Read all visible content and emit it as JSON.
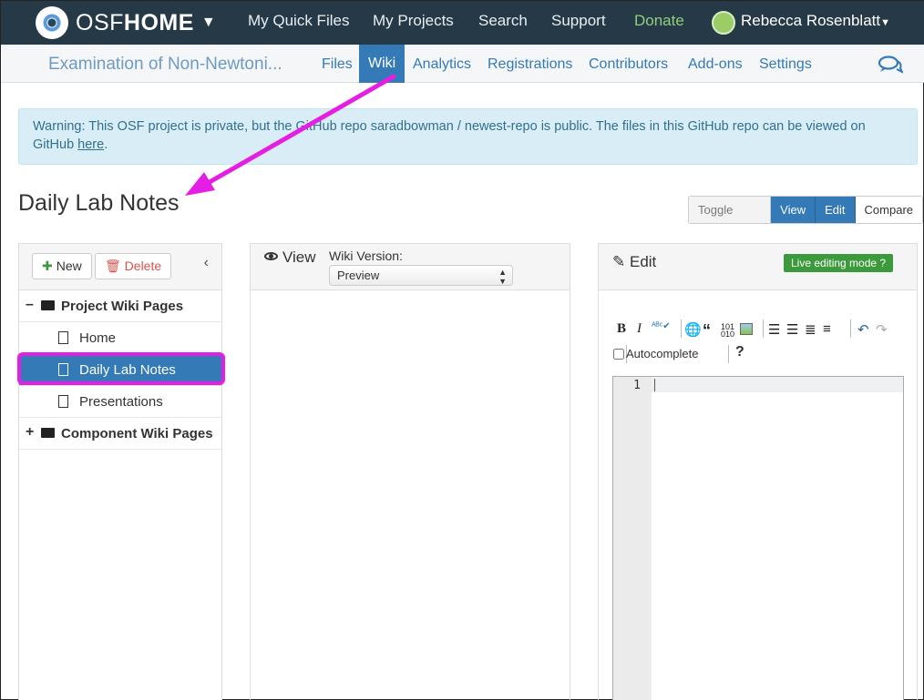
{
  "topnav": {
    "brand_osf": "OSF",
    "brand_home": "HOME",
    "items": [
      "My Quick Files",
      "My Projects",
      "Search",
      "Support",
      "Donate"
    ],
    "user_name": "Rebecca Rosenblatt"
  },
  "subnav": {
    "project_title": "Examination of Non-Newtoni...",
    "items": [
      "Files",
      "Wiki",
      "Analytics",
      "Registrations",
      "Contributors",
      "Add-ons",
      "Settings"
    ],
    "active": "Wiki"
  },
  "warning": {
    "text": "Warning: This OSF project is private, but the GitHub repo saradbowman / newest-repo is public. The files in this GitHub repo can be viewed on GitHub ",
    "link": "here",
    "end": "."
  },
  "page_title": "Daily Lab Notes",
  "toggle": {
    "label": "Toggle view:",
    "view": "View",
    "edit": "Edit",
    "compare": "Compare"
  },
  "sidebar": {
    "new_label": "New",
    "delete_label": "Delete",
    "project_folder": "Project Wiki Pages",
    "pages": [
      "Home",
      "Daily Lab Notes",
      "Presentations"
    ],
    "selected": "Daily Lab Notes",
    "component_folder": "Component Wiki Pages"
  },
  "view_panel": {
    "title": "View",
    "version_label": "Wiki Version:",
    "version_value": "Preview"
  },
  "edit_panel": {
    "title": "Edit",
    "live_badge": "Live editing mode",
    "autocomplete_label": "Autocomplete",
    "help": "?",
    "line_number": "1"
  },
  "colors": {
    "topnav_bg": "#263947",
    "primary": "#337ab7",
    "donate": "#8fd07c",
    "highlight": "#e41ee4",
    "live_badge": "#3c9a3c"
  }
}
